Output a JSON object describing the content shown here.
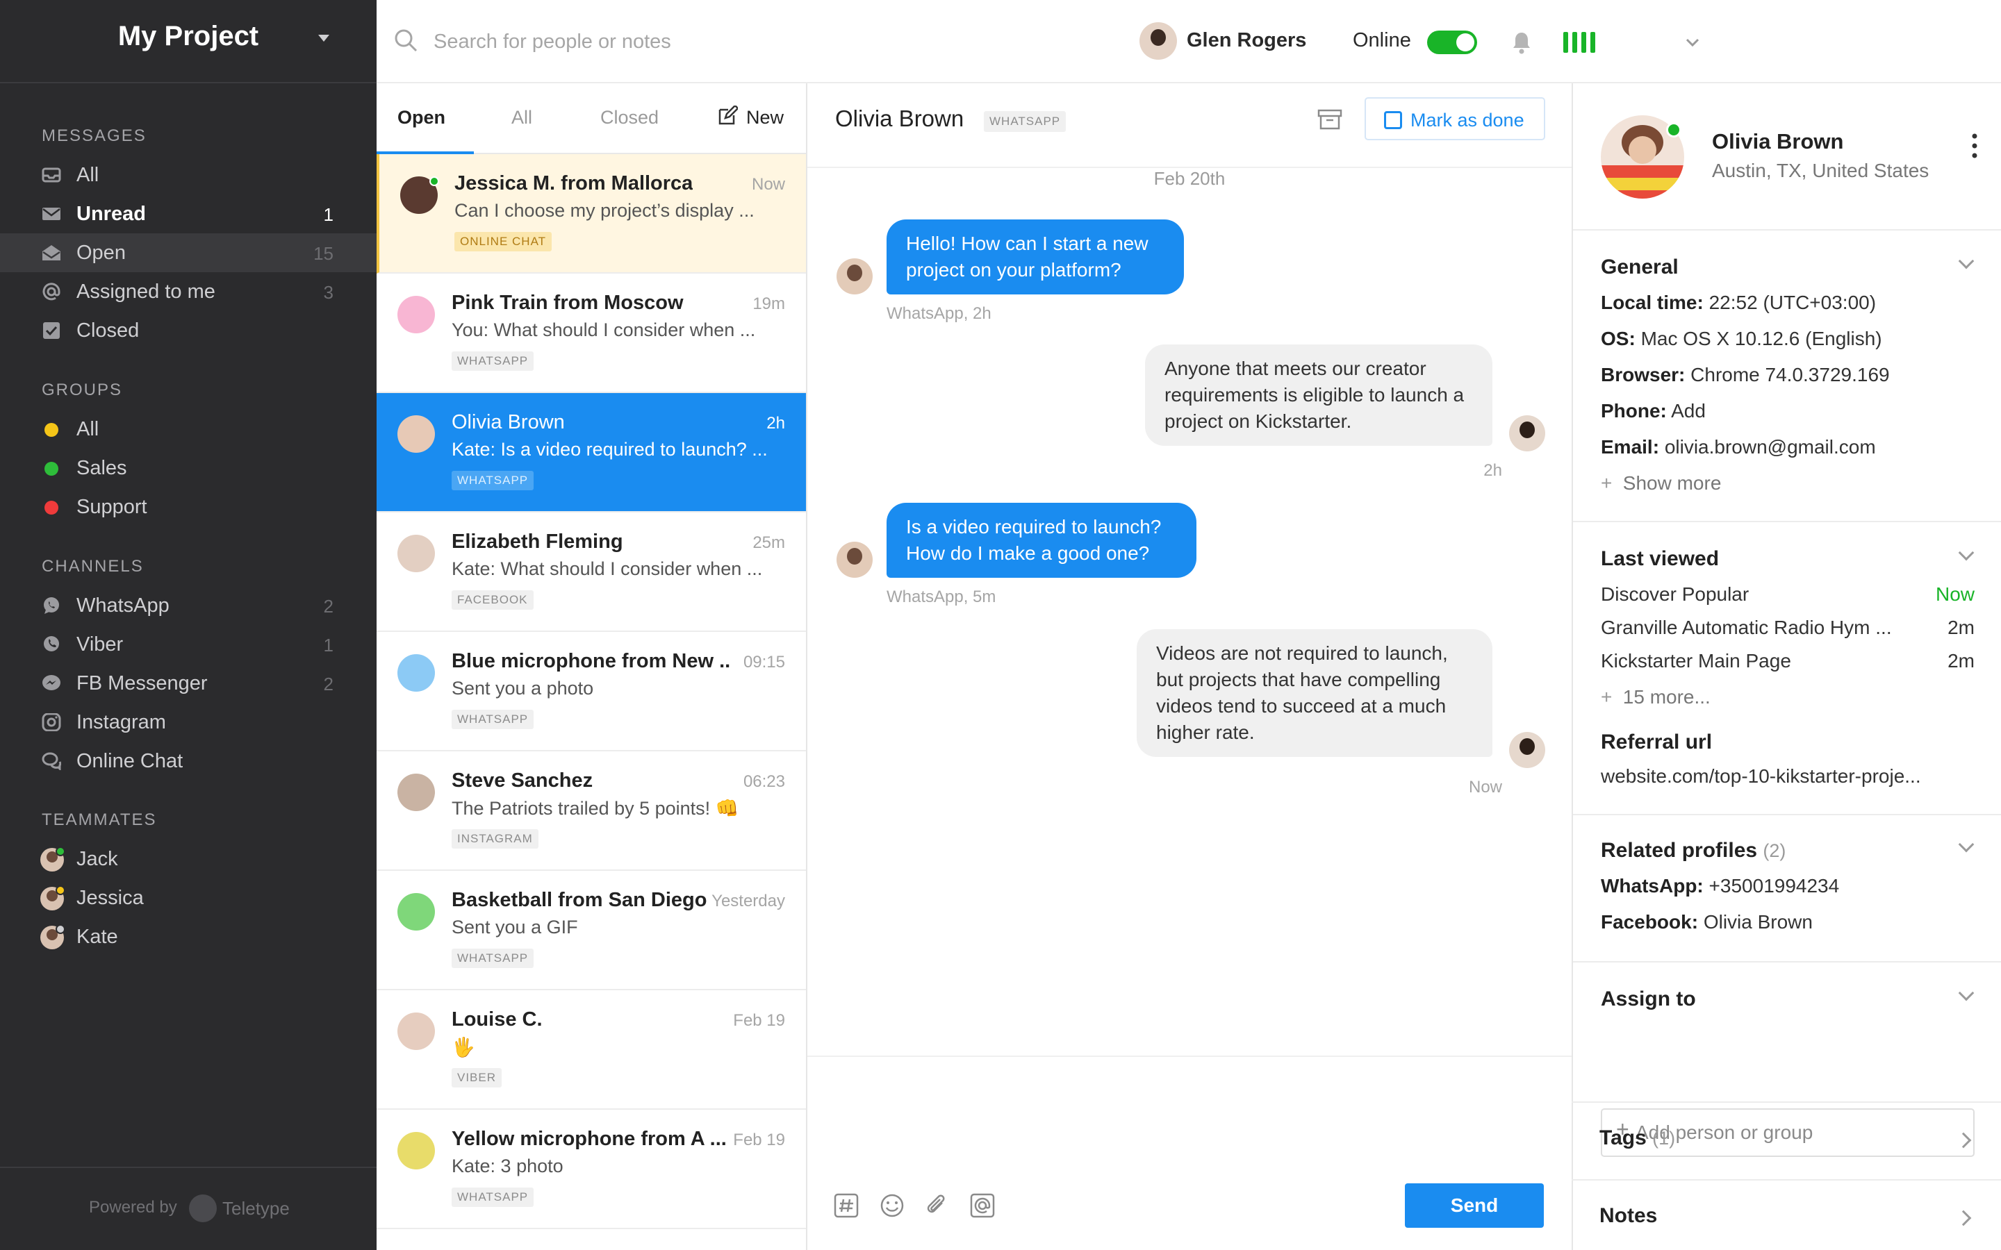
{
  "sidebar": {
    "project_title": "My Project",
    "sections": {
      "messages": "MESSAGES",
      "groups": "GROUPS",
      "channels": "CHANNELS",
      "teammates": "TEAMMATES"
    },
    "messages": [
      {
        "label": "All",
        "count": "",
        "icon": "inbox-icon"
      },
      {
        "label": "Unread",
        "count": "1",
        "icon": "envelope-icon"
      },
      {
        "label": "Open",
        "count": "15",
        "icon": "envelope-open-icon"
      },
      {
        "label": "Assigned to me",
        "count": "3",
        "icon": "at-icon"
      },
      {
        "label": "Closed",
        "count": "",
        "icon": "checkbox-icon"
      }
    ],
    "groups": [
      {
        "label": "All",
        "color": "#f5c518"
      },
      {
        "label": "Sales",
        "color": "#2ebd3a"
      },
      {
        "label": "Support",
        "color": "#ef3b3b"
      }
    ],
    "channels": [
      {
        "label": "WhatsApp",
        "count": "2",
        "icon": "whatsapp-icon"
      },
      {
        "label": "Viber",
        "count": "1",
        "icon": "viber-icon"
      },
      {
        "label": "FB Messenger",
        "count": "2",
        "icon": "messenger-icon"
      },
      {
        "label": "Instagram",
        "count": "",
        "icon": "instagram-icon"
      },
      {
        "label": "Online Chat",
        "count": "",
        "icon": "chat-bubbles-icon"
      }
    ],
    "teammates": [
      {
        "name": "Jack",
        "status_color": "#2ebd3a"
      },
      {
        "name": "Jessica",
        "status_color": "#f5c518"
      },
      {
        "name": "Kate",
        "status_color": "#cfcfd2"
      }
    ],
    "footer": {
      "powered_by": "Powered by",
      "brand": "Teletype"
    }
  },
  "topbar": {
    "search_placeholder": "Search for people or notes",
    "user_name": "Glen Rogers",
    "status_label": "Online",
    "online": true
  },
  "conversations": {
    "tabs": [
      "Open",
      "All",
      "Closed"
    ],
    "new_label": "New",
    "items": [
      {
        "name": "Jessica M. from Mallorca",
        "time": "Now",
        "preview": "Can I choose my project’s display ...",
        "channel": "ONLINE CHAT",
        "avatar_color": "#5a3a30",
        "online": true
      },
      {
        "name": "Pink Train from Moscow",
        "time": "19m",
        "preview": "You: What should I consider when ...",
        "channel": "WHATSAPP",
        "avatar_color": "#f8b6d3"
      },
      {
        "name": "Olivia Brown",
        "time": "2h",
        "preview": "Kate: Is a video required to launch? ...",
        "channel": "WHATSAPP",
        "avatar_color": "#e7c9b6"
      },
      {
        "name": "Elizabeth Fleming",
        "time": "25m",
        "preview": "Kate: What should I consider when ...",
        "channel": "FACEBOOK",
        "avatar_color": "#e3cfc2"
      },
      {
        "name": "Blue microphone from New ...",
        "time": "09:15",
        "preview": "Sent you a photo",
        "channel": "WHATSAPP",
        "avatar_color": "#8ccaf5"
      },
      {
        "name": "Steve Sanchez",
        "time": "06:23",
        "preview": "The Patriots trailed by 5 points! 👊",
        "channel": "INSTAGRAM",
        "avatar_color": "#c9b3a3"
      },
      {
        "name": "Basketball from San Diego",
        "time": "Yesterday",
        "preview": "Sent you a GIF",
        "channel": "WHATSAPP",
        "avatar_color": "#7fd77a"
      },
      {
        "name": "Louise C.",
        "time": "Feb 19",
        "preview": "🖐",
        "channel": "VIBER",
        "avatar_color": "#e6cdbf"
      },
      {
        "name": "Yellow microphone from A ...",
        "time": "Feb 19",
        "preview": "Kate: 3 photo",
        "channel": "WHATSAPP",
        "avatar_color": "#e8dc6a"
      }
    ]
  },
  "chat": {
    "contact_name": "Olivia Brown",
    "channel": "WHATSAPP",
    "mark_done_label": "Mark as done",
    "date_separator": "Feb 20th",
    "messages": [
      {
        "text": "Hello! How can I start a new project on your platform?",
        "meta": "WhatsApp, 2h"
      },
      {
        "text": "Anyone that meets our creator requirements is eligible to launch a project on Kickstarter.",
        "meta": "2h"
      },
      {
        "text": "Is a video required to launch? How do I make a good one?",
        "meta": "WhatsApp, 5m"
      },
      {
        "text": "Videos are not required to launch, but projects that have compelling videos tend to succeed at a much higher rate.",
        "meta": "Now"
      }
    ],
    "send_label": "Send",
    "tools": [
      "hashtag-icon",
      "emoji-icon",
      "paperclip-icon",
      "mention-icon"
    ]
  },
  "details": {
    "name": "Olivia Brown",
    "location": "Austin, TX, United States",
    "general": {
      "title": "General",
      "rows": [
        {
          "label": "Local time:",
          "value": "22:52 (UTC+03:00)"
        },
        {
          "label": "OS:",
          "value": "Mac OS X 10.12.6 (English)"
        },
        {
          "label": "Browser:",
          "value": "Chrome 74.0.3729.169"
        },
        {
          "label": "Phone:",
          "value": "Add"
        },
        {
          "label": "Email:",
          "value": "olivia.brown@gmail.com"
        }
      ],
      "show_more": "Show more"
    },
    "last_viewed": {
      "title": "Last viewed",
      "items": [
        {
          "page": "Discover Popular",
          "time": "Now"
        },
        {
          "page": "Granville Automatic Radio Hym ...",
          "time": "2m"
        },
        {
          "page": "Kickstarter Main Page",
          "time": "2m"
        }
      ],
      "more": "15 more...",
      "referral_title": "Referral url",
      "referral_url": "website.com/top-10-kikstarter-proje..."
    },
    "related": {
      "title": "Related profiles",
      "count": "(2)",
      "rows": [
        {
          "label": "WhatsApp:",
          "value": "+35001994234"
        },
        {
          "label": "Facebook:",
          "value": "Olivia Brown"
        }
      ]
    },
    "assign": {
      "title": "Assign to",
      "placeholder": "Add person or group"
    },
    "tags": {
      "title": "Tags",
      "count": "(1)"
    },
    "notes": {
      "title": "Notes"
    }
  }
}
